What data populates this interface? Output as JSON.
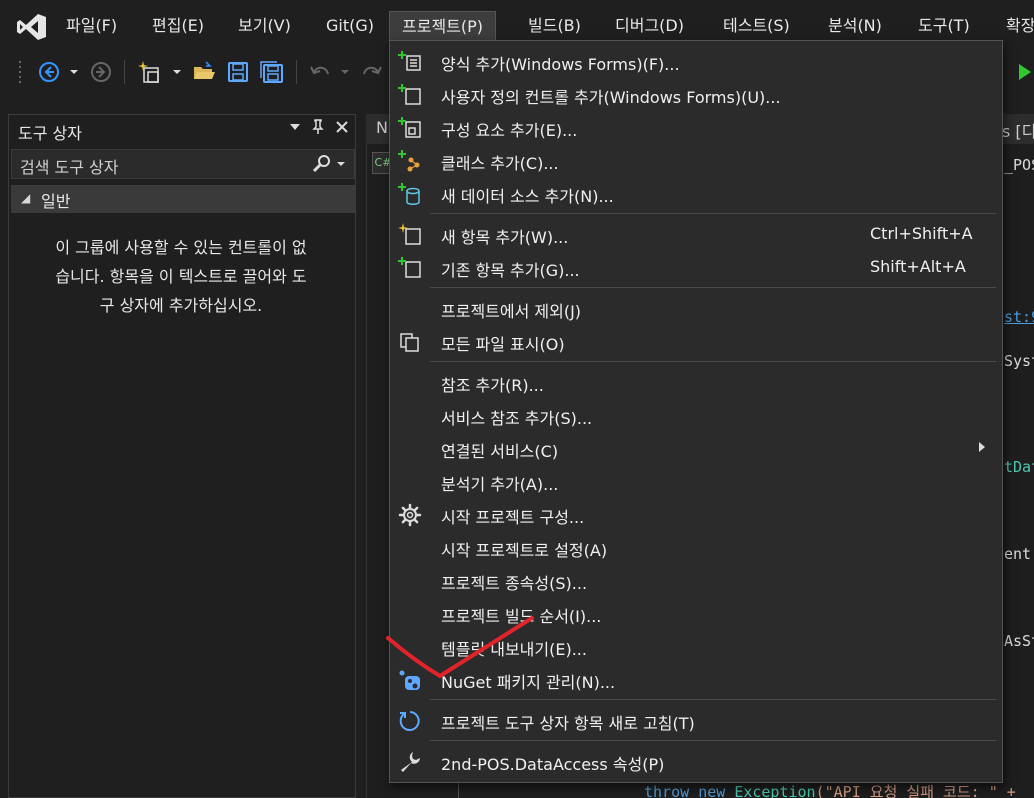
{
  "menubar": {
    "items": [
      {
        "label": "파일(F)"
      },
      {
        "label": "편집(E)"
      },
      {
        "label": "보기(V)"
      },
      {
        "label": "Git(G)"
      },
      {
        "label": "프로젝트(P)"
      },
      {
        "label": "빌드(B)"
      },
      {
        "label": "디버그(D)"
      },
      {
        "label": "테스트(S)"
      },
      {
        "label": "분석(N)"
      },
      {
        "label": "도구(T)"
      },
      {
        "label": "확장"
      }
    ]
  },
  "toolbox": {
    "title": "도구 상자",
    "search_placeholder": "검색 도구 상자",
    "group_label": "일반",
    "empty_lines": [
      "이 그룹에 사용할 수 있는 컨트롤이 없",
      "습니다. 항목을 이 텍스트로 끌어와 도",
      "구 상자에 추가하십시오."
    ]
  },
  "editor": {
    "tab_left": "N",
    "tab_right": "s [디",
    "nav_chip": "C#",
    "fragments": [
      {
        "text": "_POS",
        "color": "#dcdcdc"
      },
      {
        "text": "st:9",
        "color": "#4f9fe0"
      },
      {
        "text": "Syst",
        "color": "#dcdcdc"
      },
      {
        "text": "tDat",
        "color": "#4ec9b0"
      },
      {
        "text": "ent",
        "color": "#dcdcdc"
      },
      {
        "text": "AsSt",
        "color": "#dcdcdc"
      }
    ],
    "bottom_code": {
      "kw1": "throw",
      "kw2": "new",
      "type": "Exception",
      "str": "(\"API 요청 실패 코드: \" +"
    }
  },
  "dropdown": {
    "items": [
      {
        "icon": "add-form-icon",
        "label": "양식 추가(Windows Forms)(F)...",
        "shortcut": ""
      },
      {
        "icon": "add-user-control-icon",
        "label": "사용자 정의 컨트롤 추가(Windows Forms)(U)...",
        "shortcut": ""
      },
      {
        "icon": "add-component-icon",
        "label": "구성 요소 추가(E)...",
        "shortcut": ""
      },
      {
        "icon": "add-class-icon",
        "label": "클래스 추가(C)...",
        "shortcut": ""
      },
      {
        "icon": "add-data-source-icon",
        "label": "새 데이터 소스 추가(N)...",
        "shortcut": ""
      },
      {
        "icon": "new-item-icon",
        "label": "새 항목 추가(W)...",
        "shortcut": "Ctrl+Shift+A"
      },
      {
        "icon": "existing-item-icon",
        "label": "기존 항목 추가(G)...",
        "shortcut": "Shift+Alt+A"
      },
      {
        "icon": "",
        "label": "프로젝트에서 제외(J)",
        "shortcut": ""
      },
      {
        "icon": "show-all-files-icon",
        "label": "모든 파일 표시(O)",
        "shortcut": ""
      },
      {
        "icon": "",
        "label": "참조 추가(R)...",
        "shortcut": ""
      },
      {
        "icon": "",
        "label": "서비스 참조 추가(S)...",
        "shortcut": ""
      },
      {
        "icon": "",
        "label": "연결된 서비스(C)",
        "shortcut": ""
      },
      {
        "icon": "",
        "label": "분석기 추가(A)...",
        "shortcut": ""
      },
      {
        "icon": "gear-icon",
        "label": "시작 프로젝트 구성...",
        "shortcut": ""
      },
      {
        "icon": "",
        "label": "시작 프로젝트로 설정(A)",
        "shortcut": ""
      },
      {
        "icon": "",
        "label": "프로젝트 종속성(S)...",
        "shortcut": ""
      },
      {
        "icon": "",
        "label": "프로젝트 빌드 순서(I)...",
        "shortcut": ""
      },
      {
        "icon": "",
        "label": "템플릿 내보내기(E)...",
        "shortcut": ""
      },
      {
        "icon": "nuget-icon",
        "label": "NuGet 패키지 관리(N)...",
        "shortcut": ""
      },
      {
        "icon": "refresh-icon",
        "label": "프로젝트 도구 상자 항목 새로 고침(T)",
        "shortcut": ""
      },
      {
        "icon": "wrench-icon",
        "label": "2nd-POS.DataAccess 속성(P)",
        "shortcut": ""
      }
    ]
  },
  "colors": {
    "accent": "#3794ff",
    "save": "#5fa8ff",
    "folder": "#dcb65a",
    "green": "#2fc92f",
    "annotation": "#e0242a"
  }
}
